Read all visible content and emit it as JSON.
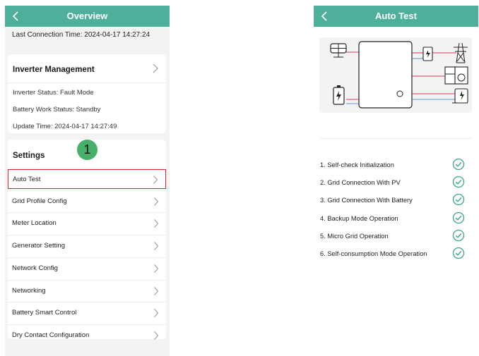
{
  "overview": {
    "title": "Overview",
    "last_connection": "Last Connection Time: 2024-04-17 14:27:24",
    "inverter_management": {
      "heading": "Inverter Management",
      "inverter_status": "Inverter Status: Fault Mode",
      "battery_status": "Battery Work Status: Standby",
      "update_time": "Update Time: 2024-04-17 14:27:49"
    },
    "settings": {
      "heading": "Settings",
      "items": [
        {
          "label": "Auto Test",
          "selected": true
        },
        {
          "label": "Grid Profile Config"
        },
        {
          "label": "Meter Location"
        },
        {
          "label": "Generator Setting"
        },
        {
          "label": "Network Config"
        },
        {
          "label": "Networking"
        },
        {
          "label": "Battery Smart Control"
        },
        {
          "label": "Dry Contact Configuration"
        }
      ]
    },
    "step_badge": "1"
  },
  "auto_test": {
    "title": "Auto Test",
    "tests": [
      {
        "label": "1. Self-check Initialization",
        "status": "passed"
      },
      {
        "label": "2. Grid Connection With PV",
        "status": "passed"
      },
      {
        "label": "3. Grid Connection With Battery",
        "status": "passed"
      },
      {
        "label": "4. Backup Mode Operation",
        "status": "passed"
      },
      {
        "label": "5. Micro Grid Operation",
        "status": "passed"
      },
      {
        "label": "6. Self-consumption Mode Operation",
        "status": "passed"
      }
    ],
    "diagram_icons": [
      "solar-panel-icon",
      "battery-icon",
      "meter-icon",
      "power-tower-icon",
      "appliances-icon",
      "generator-icon"
    ]
  },
  "colors": {
    "header": "#4eaf9b",
    "highlight_border": "#d8252e",
    "badge": "#46b06a",
    "check": "#3aa77f",
    "grid_line": "#e0607a",
    "load_line": "#7fa7d9"
  }
}
